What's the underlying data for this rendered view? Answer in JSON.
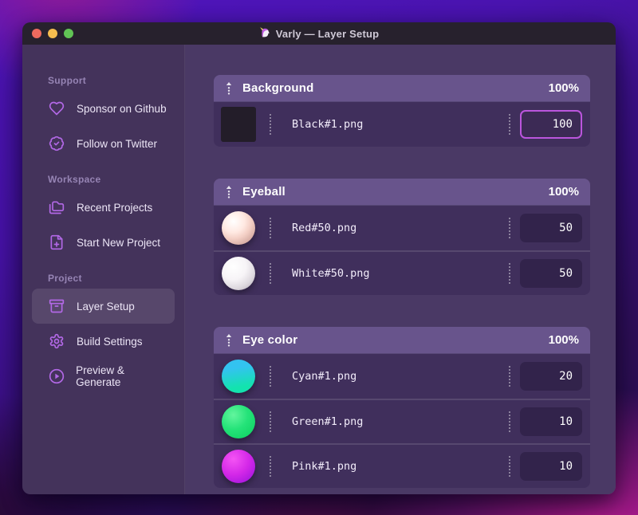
{
  "titlebar": {
    "app_icon": "unicorn-icon",
    "title": "Varly — Layer Setup"
  },
  "sidebar": {
    "sections": [
      {
        "label": "Support",
        "items": [
          {
            "icon": "heart-icon",
            "label": "Sponsor on Github",
            "selected": false
          },
          {
            "icon": "badge-check-icon",
            "label": "Follow on Twitter",
            "selected": false
          }
        ]
      },
      {
        "label": "Workspace",
        "items": [
          {
            "icon": "folders-icon",
            "label": "Recent Projects",
            "selected": false
          },
          {
            "icon": "file-plus-icon",
            "label": "Start New Project",
            "selected": false
          }
        ]
      },
      {
        "label": "Project",
        "items": [
          {
            "icon": "archive-icon",
            "label": "Layer Setup",
            "selected": true
          },
          {
            "icon": "gear-icon",
            "label": "Build Settings",
            "selected": false
          },
          {
            "icon": "play-circle-icon",
            "label": "Preview & Generate",
            "selected": false
          }
        ]
      }
    ]
  },
  "main": {
    "groups": [
      {
        "name": "Background",
        "weight": "100%",
        "items": [
          {
            "thumb": "black-square",
            "file": "Black#1.png",
            "value": "100",
            "focused": true
          }
        ]
      },
      {
        "name": "Eyeball",
        "weight": "100%",
        "items": [
          {
            "thumb": "red-sphere",
            "file": "Red#50.png",
            "value": "50",
            "focused": false
          },
          {
            "thumb": "white-sphere",
            "file": "White#50.png",
            "value": "50",
            "focused": false
          }
        ]
      },
      {
        "name": "Eye color",
        "weight": "100%",
        "items": [
          {
            "thumb": "cyan-ball",
            "file": "Cyan#1.png",
            "value": "20",
            "focused": false
          },
          {
            "thumb": "green-ball",
            "file": "Green#1.png",
            "value": "10",
            "focused": false
          },
          {
            "thumb": "pink-ball",
            "file": "Pink#1.png",
            "value": "10",
            "focused": false
          }
        ]
      }
    ]
  },
  "colors": {
    "accent": "#b268e6",
    "focus_border": "#bb55dd",
    "traffic_red": "#ee6a5f",
    "traffic_yellow": "#f5bd4f",
    "traffic_green": "#61c455"
  }
}
